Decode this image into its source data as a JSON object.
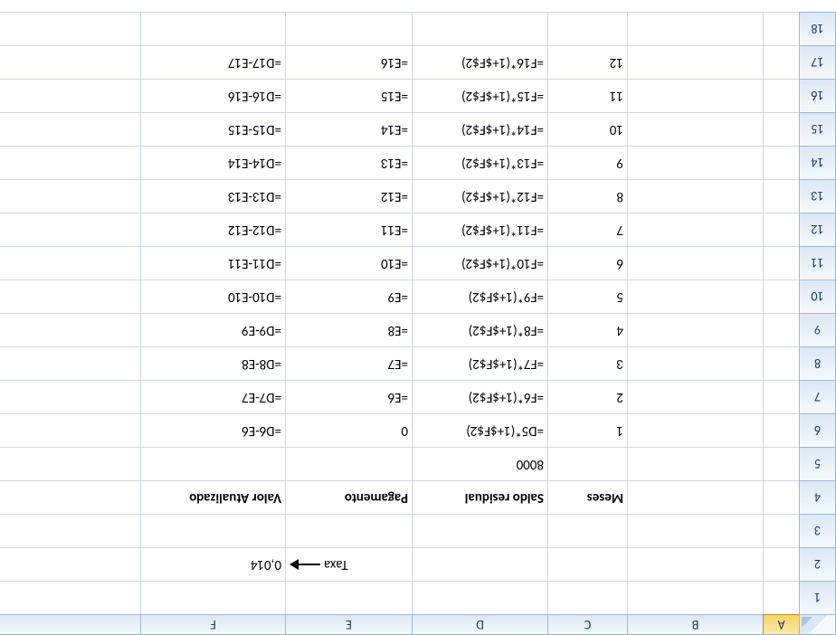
{
  "columns": [
    "A",
    "B",
    "C",
    "D",
    "E",
    "F"
  ],
  "rows": [
    "1",
    "2",
    "3",
    "4",
    "5",
    "6",
    "7",
    "8",
    "9",
    "10",
    "11",
    "12",
    "13",
    "14",
    "15",
    "16",
    "17",
    "18"
  ],
  "selected_col": "A",
  "taxa_label": "Taxa",
  "taxa_value": "0,014",
  "headers": {
    "meses": "Meses",
    "saldo": "Saldo residual",
    "pagamento": "Pagamento",
    "valor": "Valor Atualizado"
  },
  "initial_saldo": "8000",
  "table": [
    {
      "mes": "1",
      "saldo": "=D5*(1+$F$2)",
      "pag": "0",
      "val": "=D6-E6"
    },
    {
      "mes": "2",
      "saldo": "=F6*(1+$F$2)",
      "pag": "=E6",
      "val": "=D7-E7"
    },
    {
      "mes": "3",
      "saldo": "=F7*(1+$F$2)",
      "pag": "=E7",
      "val": "=D8-E8"
    },
    {
      "mes": "4",
      "saldo": "=F8*(1+$F$2)",
      "pag": "=E8",
      "val": "=D9-E9"
    },
    {
      "mes": "5",
      "saldo": "=F9*(1+$F$2)",
      "pag": "=E9",
      "val": "=D10-E10"
    },
    {
      "mes": "6",
      "saldo": "=F10*(1+$F$2)",
      "pag": "=E10",
      "val": "=D11-E11"
    },
    {
      "mes": "7",
      "saldo": "=F11*(1+$F$2)",
      "pag": "=E11",
      "val": "=D12-E12"
    },
    {
      "mes": "8",
      "saldo": "=F12*(1+$F$2)",
      "pag": "=E12",
      "val": "=D13-E13"
    },
    {
      "mes": "9",
      "saldo": "=F13*(1+$F$2)",
      "pag": "=E13",
      "val": "=D14-E14"
    },
    {
      "mes": "10",
      "saldo": "=F14*(1+$F$2)",
      "pag": "=E14",
      "val": "=D15-E15"
    },
    {
      "mes": "11",
      "saldo": "=F15*(1+$F$2)",
      "pag": "=E15",
      "val": "=D16-E16"
    },
    {
      "mes": "12",
      "saldo": "=F16*(1+$F$2)",
      "pag": "=E16",
      "val": "=D17-E17"
    }
  ]
}
